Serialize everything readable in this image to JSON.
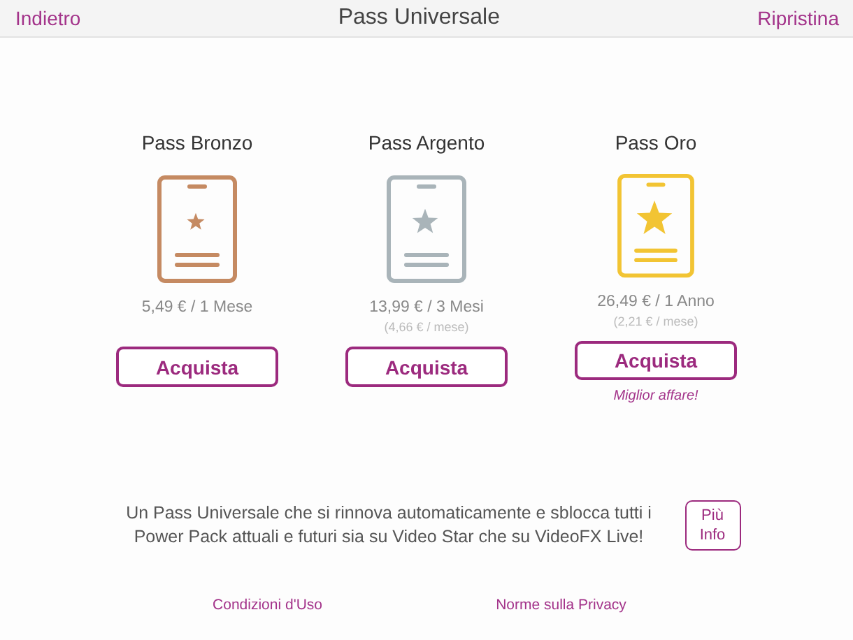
{
  "nav": {
    "back": "Indietro",
    "title": "Pass Universale",
    "restore": "Ripristina"
  },
  "passes": [
    {
      "name": "Pass Bronzo",
      "color": "#c58a62",
      "price": "5,49 € / 1 Mese",
      "button": "Acquista"
    },
    {
      "name": "Pass Argento",
      "color": "#a9b4b9",
      "price": "13,99 € / 3 Mesi",
      "per_month": "(4,66 € / mese)",
      "button": "Acquista"
    },
    {
      "name": "Pass Oro",
      "color": "#f2c433",
      "price": "26,49 € / 1 Anno",
      "per_month": "(2,21 € / mese)",
      "button": "Acquista",
      "note": "Miglior affare!"
    }
  ],
  "description": "Un Pass Universale che si rinnova automaticamente e sblocca tutti i Power Pack attuali e futuri sia su Video Star che su VideoFX Live!",
  "info_button": [
    "Più",
    "Info"
  ],
  "links": [
    "Condizioni d'Uso",
    "Norme sulla Privacy"
  ]
}
